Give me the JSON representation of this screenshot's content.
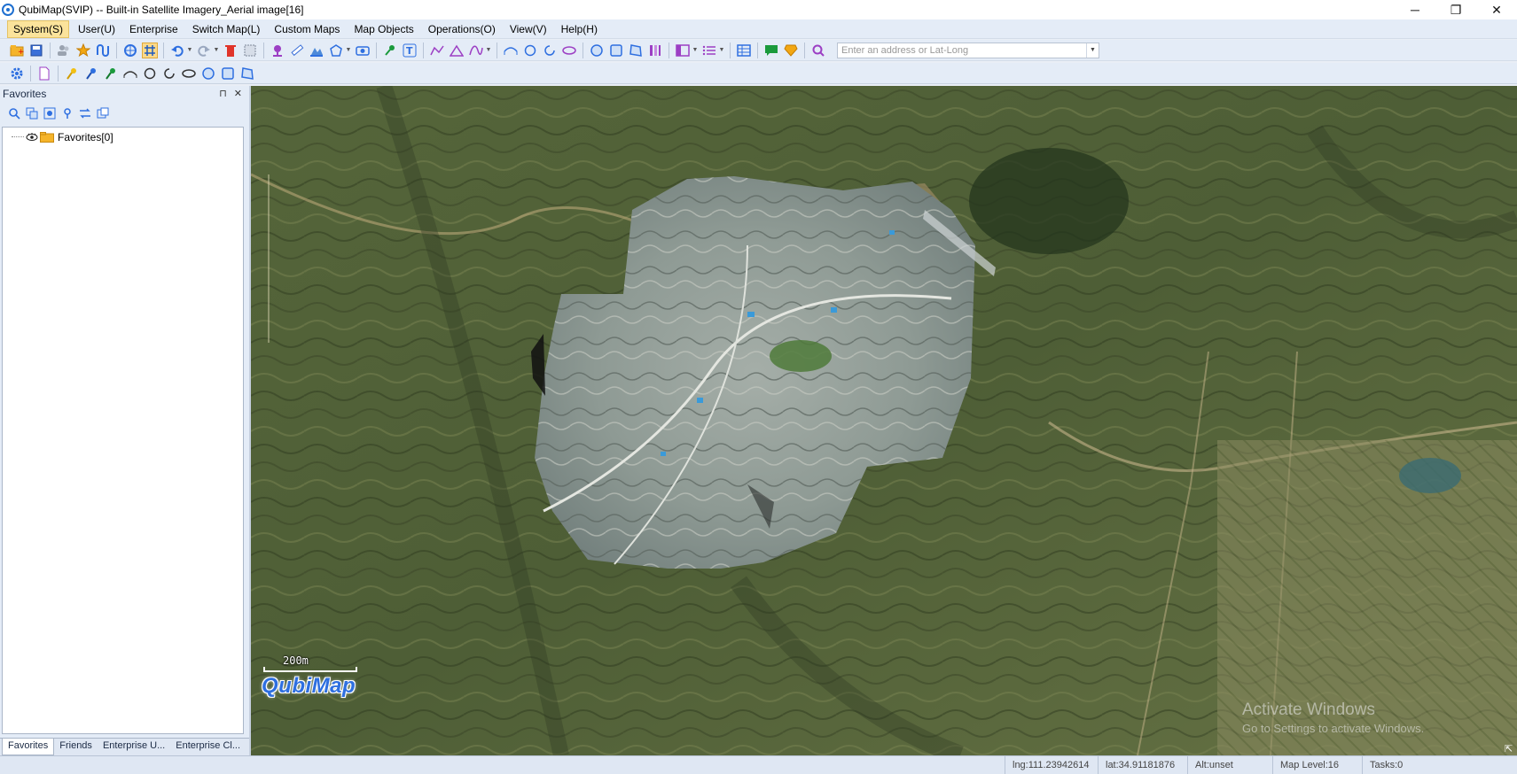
{
  "window": {
    "title": "QubiMap(SVIP) -- Built-in Satellite Imagery_Aerial image[16]",
    "minimize": "─",
    "restore": "❐",
    "close": "✕"
  },
  "menu": {
    "items": [
      "System(S)",
      "User(U)",
      "Enterprise",
      "Switch Map(L)",
      "Custom Maps",
      "Map Objects",
      "Operations(O)",
      "View(V)",
      "Help(H)"
    ]
  },
  "search": {
    "placeholder": "Enter an address or Lat-Long",
    "value": ""
  },
  "panel": {
    "title": "Favorites",
    "pin": "⊓",
    "close": "✕",
    "tree_root": "Favorites[0]",
    "tabs": [
      "Favorites",
      "Friends",
      "Enterprise U...",
      "Enterprise Cl..."
    ]
  },
  "map": {
    "scale_label": "200m",
    "logo": "QubiMap",
    "watermark_line1": "Activate Windows",
    "watermark_line2": "Go to Settings to activate Windows."
  },
  "status": {
    "lng": "lng:111.23942614",
    "lat": "lat:34.91181876",
    "alt": "Alt:unset",
    "map_level": "Map Level:16",
    "tasks": "Tasks:0"
  },
  "colors": {
    "accent": "#2e6fe0",
    "chrome": "#e4ecf7",
    "active_menu": "#fbe39b"
  }
}
